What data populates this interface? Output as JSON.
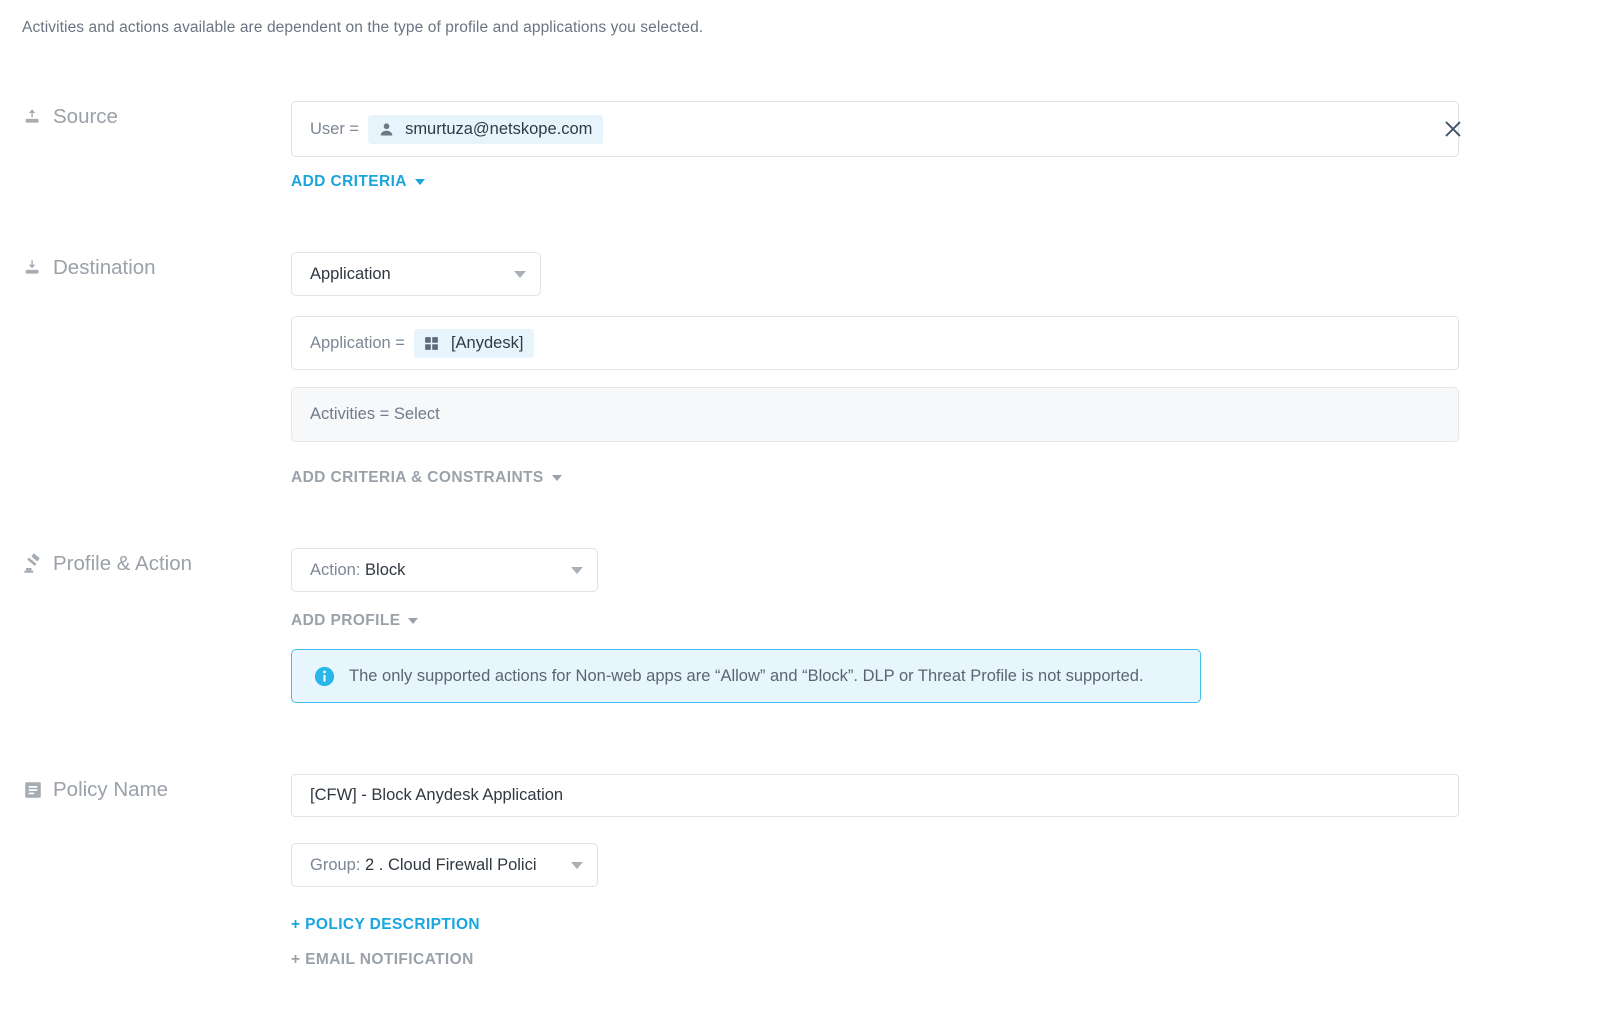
{
  "intro": {
    "text": "Activities and actions available are dependent on the type of profile and applications you selected."
  },
  "colors": {
    "link_blue": "#18a5e0",
    "muted_grey": "#9aa1a9",
    "chip_bg": "#e8f4fb",
    "info_border": "#3fc0ef",
    "info_bg": "#e7f6fd",
    "field_border": "#dfe3e6",
    "disabled_bg": "#f7f8f9",
    "text_dark": "#2f3841"
  },
  "source": {
    "label": "Source",
    "icon": "upload-icon",
    "criteria": {
      "key": "User =",
      "chip_icon": "user-icon",
      "chip_value": "smurtuza@netskope.com"
    },
    "remove_icon": "close-icon",
    "add_criteria_label": "ADD CRITERIA"
  },
  "destination": {
    "label": "Destination",
    "icon": "download-icon",
    "type_select": {
      "value": "Application",
      "caret_icon": "chevron-down-icon"
    },
    "application_criteria": {
      "key": "Application =",
      "chip_icon": "apps-grid-icon",
      "chip_value": "[Anydesk]"
    },
    "activities_field": {
      "text": "Activities = Select",
      "disabled": true
    },
    "add_criteria_label": "ADD CRITERIA & CONSTRAINTS"
  },
  "profile_action": {
    "label": "Profile & Action",
    "icon": "gavel-icon",
    "action_select": {
      "prefix": "Action:",
      "value": "Block",
      "caret_icon": "chevron-down-icon"
    },
    "add_profile_label": "ADD PROFILE",
    "info": {
      "icon": "info-circle-icon",
      "text": "The only supported actions for Non-web apps are “Allow” and “Block”. DLP or Threat Profile is not supported."
    }
  },
  "policy_name": {
    "label": "Policy Name",
    "icon": "document-lines-icon",
    "name_input": {
      "value": "[CFW] - Block Anydesk Application",
      "placeholder": "Policy Name"
    },
    "group_select": {
      "prefix": "Group:",
      "value": "2 . Cloud Firewall Polici",
      "caret_icon": "chevron-down-icon"
    },
    "policy_description_link": "+ POLICY DESCRIPTION",
    "email_notification_link": "+ EMAIL NOTIFICATION"
  }
}
